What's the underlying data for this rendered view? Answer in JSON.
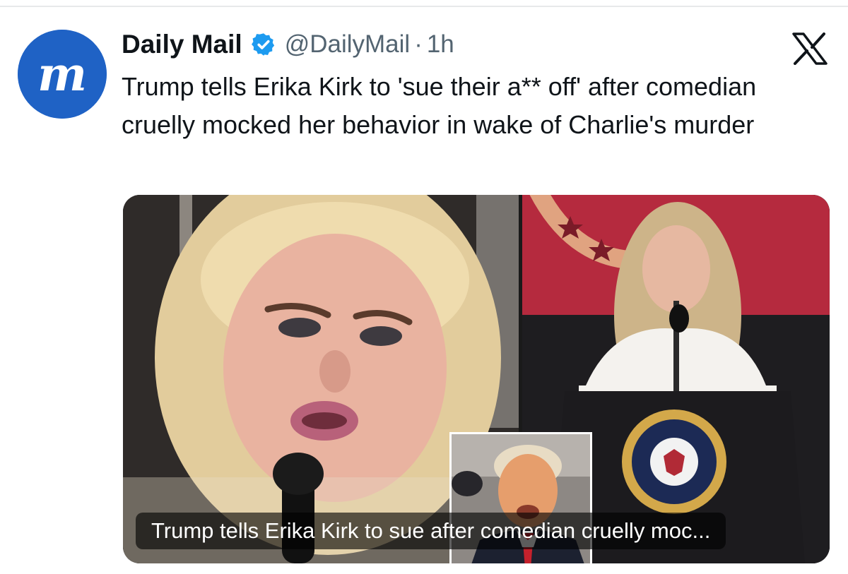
{
  "post": {
    "author_name": "Daily Mail",
    "handle": "@DailyMail",
    "separator": "·",
    "time": "1h",
    "text": "Trump tells Erika Kirk to 'sue their a** off' after comedian cruelly mocked her behavior in wake of Charlie's murder",
    "verified": true
  },
  "card": {
    "caption": "Trump tells Erika Kirk to sue after comedian cruelly moc..."
  },
  "icons": {
    "avatar": "daily-mail-logo",
    "verified": "verified-badge-icon",
    "platform": "x-logo-icon"
  },
  "colors": {
    "avatar_bg": "#1f62c5",
    "verified_badge": "#1d9bf0",
    "secondary_text": "#536471",
    "primary_text": "#0f1419"
  }
}
